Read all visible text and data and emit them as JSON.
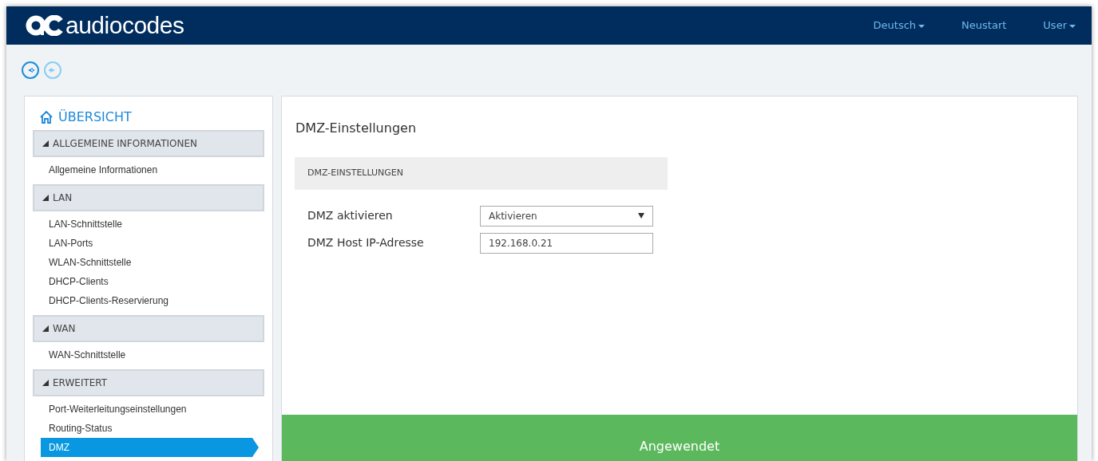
{
  "header": {
    "logo_text": "audiocodes",
    "menu": [
      {
        "label": "Deutsch",
        "dropdown": true
      },
      {
        "label": "Neustart",
        "dropdown": false
      },
      {
        "label": "User",
        "dropdown": true
      }
    ]
  },
  "history": [
    {
      "kind": "back",
      "disabled": false
    },
    {
      "kind": "forward",
      "disabled": true
    }
  ],
  "sidebar": {
    "title": "ÜBERSICHT",
    "sections": [
      {
        "label": "ALLGEMEINE INFORMATIONEN",
        "expanded": true,
        "items": [
          {
            "label": "Allgemeine Informationen",
            "selected": false
          }
        ]
      },
      {
        "label": "LAN",
        "expanded": true,
        "items": [
          {
            "label": "LAN-Schnittstelle",
            "selected": false
          },
          {
            "label": "LAN-Ports",
            "selected": false
          },
          {
            "label": "WLAN-Schnittstelle",
            "selected": false
          },
          {
            "label": "DHCP-Clients",
            "selected": false
          },
          {
            "label": "DHCP-Clients-Reservierung",
            "selected": false
          }
        ]
      },
      {
        "label": "WAN",
        "expanded": true,
        "items": [
          {
            "label": "WAN-Schnittstelle",
            "selected": false
          }
        ]
      },
      {
        "label": "ERWEITERT",
        "expanded": true,
        "items": [
          {
            "label": "Port-Weiterleitungseinstellungen",
            "selected": false
          },
          {
            "label": "Routing-Status",
            "selected": false
          },
          {
            "label": "DMZ",
            "selected": true
          }
        ]
      }
    ]
  },
  "main": {
    "title": "DMZ-Einstellungen",
    "section": "DMZ-EINSTELLUNGEN",
    "fields": [
      {
        "kind": "select",
        "label": "DMZ aktivieren",
        "value": "Aktivieren"
      },
      {
        "kind": "text",
        "label": "DMZ Host IP-Adresse",
        "value": "192.168.0.21"
      }
    ],
    "status": "Angewendet"
  }
}
